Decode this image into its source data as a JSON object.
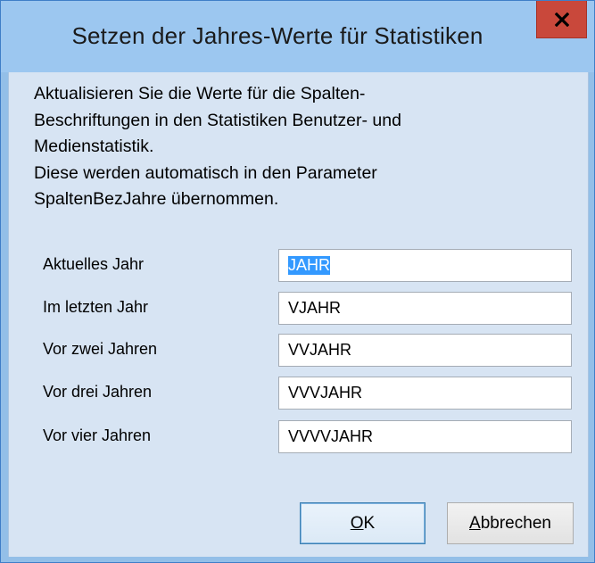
{
  "window": {
    "title": "Setzen der Jahres-Werte für Statistiken",
    "close_symbol": "x"
  },
  "description": {
    "lines": [
      "Aktualisieren Sie die Werte für die Spalten-",
      "Beschriftungen in den Statistiken Benutzer- und",
      "Medienstatistik.",
      "Diese werden automatisch in den Parameter",
      "SpaltenBezJahre übernommen."
    ]
  },
  "fields": [
    {
      "label": "Aktuelles Jahr",
      "value": "JAHR",
      "selected": true
    },
    {
      "label": "Im letzten Jahr",
      "value": "VJAHR"
    },
    {
      "label": "Vor zwei Jahren",
      "value": "VVJAHR"
    },
    {
      "label": "Vor drei Jahren",
      "value": "VVVJAHR"
    },
    {
      "label": "Vor vier Jahren",
      "value": "VVVVJAHR"
    }
  ],
  "buttons": {
    "ok": {
      "mnemonic": "O",
      "rest": "K"
    },
    "cancel": {
      "mnemonic": "A",
      "rest": "bbrechen"
    }
  },
  "colors": {
    "titlebar": "#9cc7f0",
    "client_bg": "#d7e4f3",
    "close_button": "#c9483b",
    "selection": "#3399ff"
  },
  "icons": {
    "close": "close-icon"
  }
}
